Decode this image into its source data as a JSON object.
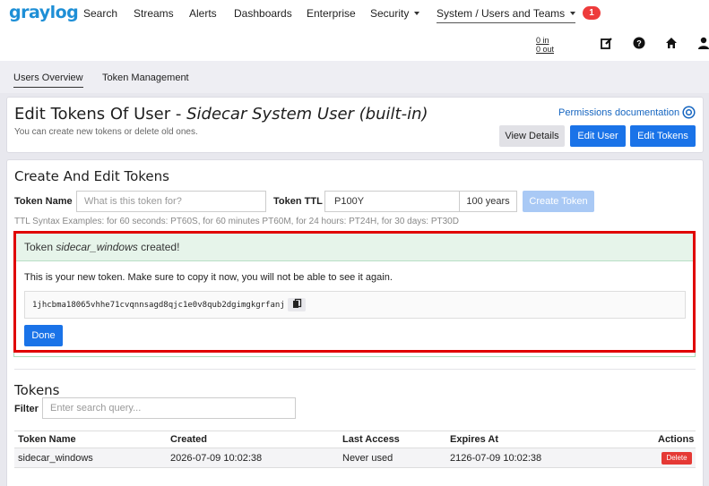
{
  "nav": {
    "logo": "graylog",
    "items": [
      "Search",
      "Streams",
      "Alerts",
      "Dashboards",
      "Enterprise"
    ],
    "security_label": "Security",
    "system_label": "System / Users and Teams",
    "notification_count": "1",
    "throughput_in": "0 in",
    "throughput_out": "0 out",
    "icons": [
      "edit-icon",
      "help-icon",
      "home-icon",
      "user-icon"
    ]
  },
  "subnav": {
    "users_overview": "Users Overview",
    "token_management": "Token Management"
  },
  "header": {
    "title_prefix": "Edit Tokens Of User - ",
    "title_user": "Sidecar System User (built-in)",
    "subtitle": "You can create new tokens or delete old ones.",
    "permissions_link": "Permissions documentation",
    "view_details": "View Details",
    "edit_user": "Edit User",
    "edit_tokens": "Edit Tokens"
  },
  "create": {
    "title": "Create And Edit Tokens",
    "token_name_label": "Token Name",
    "token_name_placeholder": "What is this token for?",
    "token_ttl_label": "Token TTL",
    "token_ttl_value": "P100Y",
    "ttl_readable": "100 years",
    "create_button": "Create Token",
    "ttl_hint": "TTL Syntax Examples: for 60 seconds: PT60S, for 60 minutes PT60M, for 24 hours: PT24H, for 30 days: PT30D"
  },
  "alert": {
    "prefix": "Token ",
    "token_name": "sidecar_windows",
    "suffix": " created!",
    "message": "This is your new token. Make sure to copy it now, you will not be able to see it again.",
    "token_value": "1jhcbma18065vhhe71cvqnnsagd8qjc1e0v8qub2dgimgkgrfanj",
    "done_button": "Done"
  },
  "tokens": {
    "title": "Tokens",
    "filter_label": "Filter",
    "filter_placeholder": "Enter search query...",
    "columns": [
      "Token Name",
      "Created",
      "Last Access",
      "Expires At",
      "Actions"
    ],
    "rows": [
      {
        "name": "sidecar_windows",
        "created": "2026-07-09 10:02:38",
        "last_access": "Never used",
        "expires": "2126-07-09 10:02:38",
        "action": "Delete"
      }
    ]
  },
  "colors": {
    "brand": "#1e8fd6",
    "primary": "#1a73e8",
    "highlight": "#e00000",
    "danger": "#e53935"
  }
}
